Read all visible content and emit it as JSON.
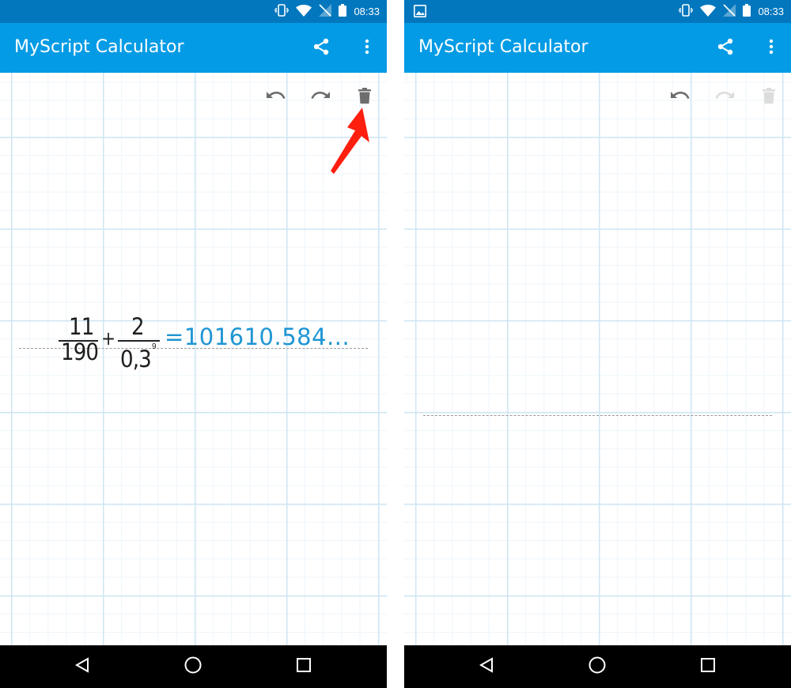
{
  "status_bar": {
    "time": "08:33"
  },
  "app": {
    "title": "MyScript Calculator"
  },
  "icons": {
    "share": "share-icon",
    "more": "more-vert-icon",
    "undo": "undo-icon",
    "redo": "redo-icon",
    "delete": "trash-icon",
    "vibrate": "vibrate-icon",
    "wifi": "wifi-icon",
    "signal": "no-signal-icon",
    "battery": "battery-icon",
    "gallery": "image-icon",
    "back": "back-icon",
    "home": "home-icon",
    "recents": "recents-icon"
  },
  "colors": {
    "status_bar": "#0277bd",
    "app_bar": "#039be5",
    "result": "#1e95d3",
    "arrow": "#ff1f0f"
  },
  "left_screen": {
    "expression": {
      "fraction1": {
        "numerator": "11",
        "denominator": "190"
      },
      "operator": "+",
      "fraction2": {
        "numerator": "2",
        "denominator": "0,3",
        "exponent": "9"
      },
      "result": "=101610.584..."
    },
    "toolbar": {
      "redo_enabled": true,
      "delete_enabled": true
    }
  },
  "right_screen": {
    "toolbar": {
      "redo_enabled": false,
      "delete_enabled": false
    }
  }
}
